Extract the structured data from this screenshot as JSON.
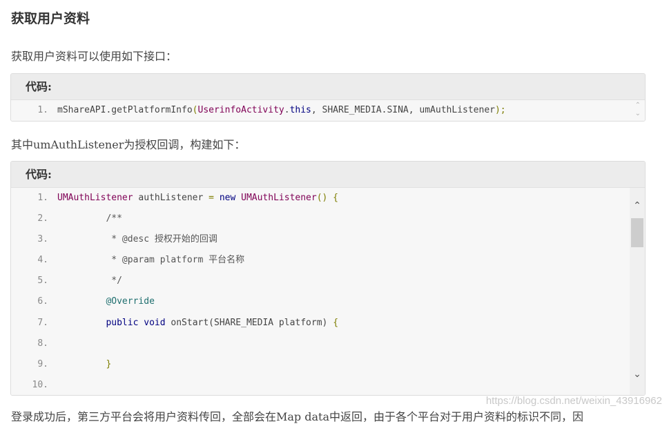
{
  "heading": "获取用户资料",
  "intro": "获取用户资料可以使用如下接口：",
  "code1": {
    "caption": "代码:",
    "lines": [
      {
        "num": "1.",
        "parts": [
          {
            "t": "mShareAPI.getPlatformInfo",
            "c": ""
          },
          {
            "t": "(",
            "c": "pn"
          },
          {
            "t": "UserinfoActivity",
            "c": "ty"
          },
          {
            "t": ".",
            "c": ""
          },
          {
            "t": "this",
            "c": "kw"
          },
          {
            "t": ", SHARE_MEDIA.SINA, umAuthListener",
            "c": ""
          },
          {
            "t": ");",
            "c": "pn"
          }
        ]
      }
    ]
  },
  "para2": "其中umAuthListener为授权回调，构建如下：",
  "code2": {
    "caption": "代码:",
    "lines": [
      {
        "num": "1.",
        "parts": [
          {
            "t": "UMAuthListener",
            "c": "ty"
          },
          {
            "t": " authListener ",
            "c": ""
          },
          {
            "t": "=",
            "c": "pn"
          },
          {
            "t": " ",
            "c": ""
          },
          {
            "t": "new",
            "c": "kw"
          },
          {
            "t": " ",
            "c": ""
          },
          {
            "t": "UMAuthListener",
            "c": "ty"
          },
          {
            "t": "() {",
            "c": "pn"
          }
        ]
      },
      {
        "num": "2.",
        "parts": [
          {
            "t": "         /**",
            "c": "cm"
          }
        ]
      },
      {
        "num": "3.",
        "parts": [
          {
            "t": "          * @desc 授权开始的回调",
            "c": "cm"
          }
        ]
      },
      {
        "num": "4.",
        "parts": [
          {
            "t": "          * @param platform 平台名称",
            "c": "cm"
          }
        ]
      },
      {
        "num": "5.",
        "parts": [
          {
            "t": "          */",
            "c": "cm"
          }
        ]
      },
      {
        "num": "6.",
        "parts": [
          {
            "t": "         ",
            "c": ""
          },
          {
            "t": "@Override",
            "c": "an"
          }
        ]
      },
      {
        "num": "7.",
        "parts": [
          {
            "t": "         ",
            "c": ""
          },
          {
            "t": "public",
            "c": "kw"
          },
          {
            "t": " ",
            "c": ""
          },
          {
            "t": "void",
            "c": "kw"
          },
          {
            "t": " onStart(SHARE_MEDIA platform) ",
            "c": ""
          },
          {
            "t": "{",
            "c": "pn"
          }
        ]
      },
      {
        "num": "8.",
        "parts": []
      },
      {
        "num": "9.",
        "parts": [
          {
            "t": "         ",
            "c": ""
          },
          {
            "t": "}",
            "c": "pn"
          }
        ]
      },
      {
        "num": "10.",
        "parts": []
      }
    ]
  },
  "bottom_text": "登录成功后，第三方平台会将用户资料传回，全部会在Map data中返回，由于各个平台对于用户资料的标识不同，因",
  "watermark": "https://blog.csdn.net/weixin_43916962",
  "icons": {
    "scroll_up": "chevron-up-icon",
    "scroll_down": "chevron-down-icon"
  }
}
